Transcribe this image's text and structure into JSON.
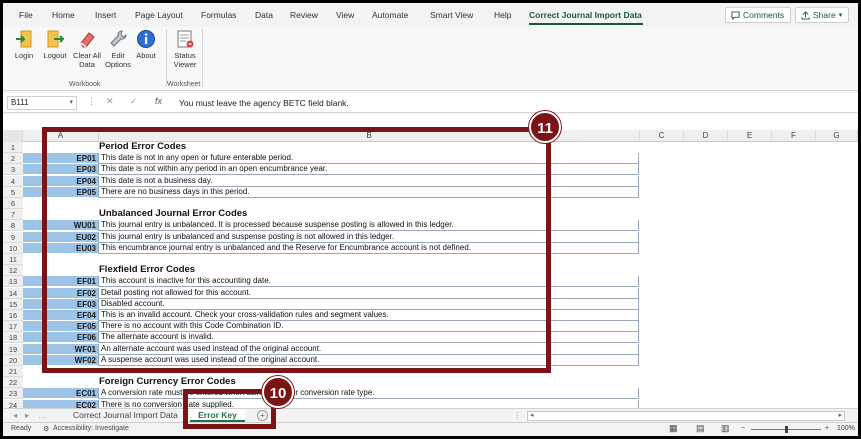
{
  "ribbon": {
    "tabs": [
      "File",
      "Home",
      "Insert",
      "Page Layout",
      "Formulas",
      "Data",
      "Review",
      "View",
      "Automate",
      "Smart View",
      "Help",
      "Correct Journal Import Data"
    ],
    "comments_label": "Comments",
    "share_label": "Share",
    "buttons": [
      {
        "label": "Login",
        "icon": "login-icon"
      },
      {
        "label": "Logout",
        "icon": "logout-icon"
      },
      {
        "label": "Clear All Data",
        "icon": "eraser-icon"
      },
      {
        "label": "Edit Options",
        "icon": "wrench-icon"
      },
      {
        "label": "About",
        "icon": "info-icon"
      },
      {
        "label": "Status Viewer",
        "icon": "status-viewer-icon"
      }
    ],
    "groups": [
      "Workbook",
      "Worksheet"
    ]
  },
  "formula_bar": {
    "name_box": "B111",
    "fx": "fx",
    "formula": "You must leave the agency BETC field blank."
  },
  "columns": [
    "A",
    "B",
    "C",
    "D",
    "E",
    "F",
    "G"
  ],
  "sheet": {
    "sections": [
      {
        "row": 1,
        "title": "Period Error Codes"
      },
      {
        "row": 7,
        "title": "Unbalanced Journal Error Codes"
      },
      {
        "row": 12,
        "title": "Flexfield Error Codes"
      },
      {
        "row": 22,
        "title": "Foreign Currency Error Codes"
      }
    ],
    "rows": [
      {
        "n": "2",
        "code": "EP01",
        "desc": "This date is not in any open or future enterable period."
      },
      {
        "n": "3",
        "code": "EP03",
        "desc": "This date is not within any period in an open encumbrance year."
      },
      {
        "n": "4",
        "code": "EP04",
        "desc": "This date is not a business day."
      },
      {
        "n": "5",
        "code": "EP05",
        "desc": "There are no business days in this period."
      },
      {
        "n": "8",
        "code": "WU01",
        "desc": "This journal entry is unbalanced. It is processed because suspense posting is allowed in this ledger."
      },
      {
        "n": "9",
        "code": "EU02",
        "desc": "This journal entry is unbalanced and suspense posting is not allowed in this ledger."
      },
      {
        "n": "10",
        "code": "EU03",
        "desc": "This encumbrance journal entry is unbalanced and the Reserve for Encumbrance account is not defined."
      },
      {
        "n": "13",
        "code": "EF01",
        "desc": "This account is inactive for this accounting date."
      },
      {
        "n": "14",
        "code": "EF02",
        "desc": "Detail posting not allowed for this account."
      },
      {
        "n": "15",
        "code": "EF03",
        "desc": "Disabled account."
      },
      {
        "n": "16",
        "code": "EF04",
        "desc": "This is an invalid account. Check your cross-validation rules and segment values."
      },
      {
        "n": "17",
        "code": "EF05",
        "desc": "There is no account with this Code Combination ID."
      },
      {
        "n": "18",
        "code": "EF06",
        "desc": "The alternate account is invalid."
      },
      {
        "n": "19",
        "code": "WF01",
        "desc": "An alternate account was used instead of the original account."
      },
      {
        "n": "20",
        "code": "WF02",
        "desc": "A suspense account was used instead of the original account."
      },
      {
        "n": "23",
        "code": "EC01",
        "desc": "A conversion rate must be entered when using the User conversion rate type."
      },
      {
        "n": "24",
        "code": "EC02",
        "desc": "There is no conversion date supplied."
      }
    ],
    "empty_rows": [
      "1",
      "6",
      "7",
      "11",
      "12",
      "21",
      "22"
    ]
  },
  "sheet_tabs": {
    "tab1": "Correct Journal Import Data",
    "tab2": "Error Key",
    "add": "+"
  },
  "status_bar": {
    "ready": "Ready",
    "accessibility": "Accessibility: Investigate",
    "zoom": "100%"
  },
  "annotations": {
    "badge_11": "11",
    "badge_10": "10"
  },
  "colors": {
    "accent": "#185c37",
    "callout": "#7b1416",
    "code_fill": "#9dc3e6"
  }
}
